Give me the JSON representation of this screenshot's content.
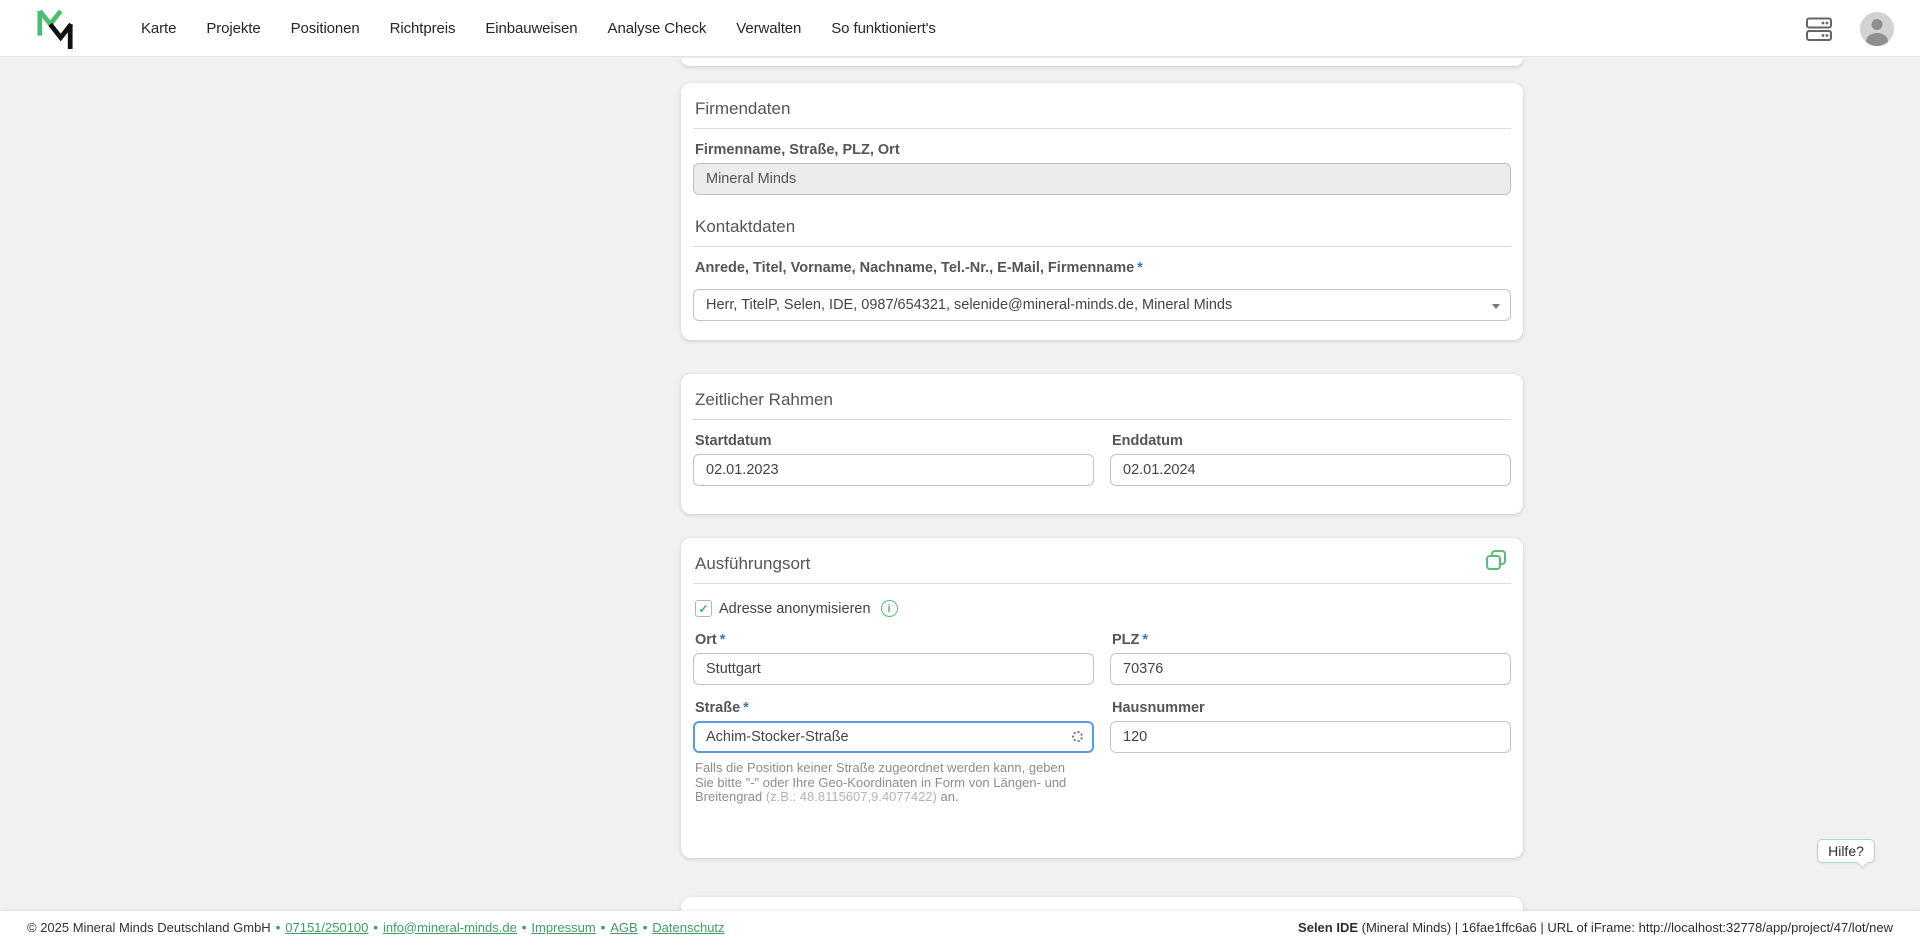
{
  "navbar": {
    "items": [
      {
        "label": "Karte"
      },
      {
        "label": "Projekte"
      },
      {
        "label": "Positionen"
      },
      {
        "label": "Richtpreis"
      },
      {
        "label": "Einbauweisen"
      },
      {
        "label": "Analyse Check"
      },
      {
        "label": "Verwalten"
      },
      {
        "label": "So funktioniert's"
      }
    ]
  },
  "company_card": {
    "title": "Firmendaten",
    "company_label": "Firmenname, Straße, PLZ, Ort",
    "company_value": "Mineral Minds",
    "contact_title": "Kontaktdaten",
    "contact_label": "Anrede, Titel, Vorname, Nachname, Tel.-Nr., E-Mail, Firmenname",
    "contact_value": "Herr, TitelP, Selen, IDE, 0987/654321, selenide@mineral-minds.de, Mineral Minds"
  },
  "timeframe_card": {
    "title": "Zeitlicher Rahmen",
    "start_label": "Startdatum",
    "start_value": "02.01.2023",
    "end_label": "Enddatum",
    "end_value": "02.01.2024"
  },
  "location_card": {
    "title": "Ausführungsort",
    "anonymize_label": "Adresse anonymisieren",
    "city_label": "Ort",
    "city_value": "Stuttgart",
    "zip_label": "PLZ",
    "zip_value": "70376",
    "street_label": "Straße",
    "street_value": "Achim-Stocker-Straße",
    "number_label": "Hausnummer",
    "number_value": "120",
    "street_help_1": "Falls die Position keiner Straße zugeordnet werden kann, geben Sie bitte \"-\" oder Ihre Geo-Koordinaten in Form von Längen- und Breitengrad ",
    "street_help_coords": "(z.B.: 48.8115607,9.4077422)",
    "street_help_2": " an."
  },
  "symbols": {
    "required_marker": "*",
    "checkmark": "✓",
    "info": "i",
    "separator": "•"
  },
  "help_button": {
    "label": "Hilfe?"
  },
  "footer": {
    "copyright": "© 2025 Mineral Minds Deutschland GmbH",
    "links": [
      {
        "label": "07151/250100"
      },
      {
        "label": "info@mineral-minds.de"
      },
      {
        "label": "Impressum"
      },
      {
        "label": "AGB"
      },
      {
        "label": "Datenschutz"
      }
    ],
    "app_info_bold": "Selen IDE",
    "app_info_rest": " (Mineral Minds) | 16fae1ffc6a6 | URL of iFrame: http://localhost:32778/app/project/47/lot/new"
  },
  "colors": {
    "brand_green": "#4dbd74",
    "link_green": "#3f9e63",
    "required_blue": "#337ab7",
    "focus_blue": "#5b9ce0",
    "page_background": "#f1f1f1"
  }
}
